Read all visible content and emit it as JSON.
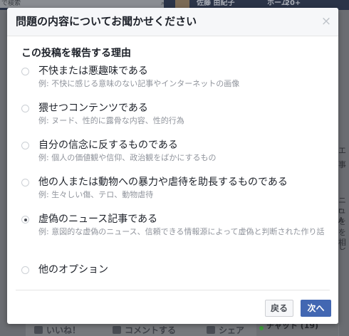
{
  "background": {
    "search_placeholder": "で検索",
    "user_name": "佐藤 由紀子",
    "home_label": "ホーム",
    "people_badge": "20+",
    "right_text_lines": [
      "エ",
      "事",
      "ニュ",
      "r A",
      "を",
      "を相",
      "し"
    ],
    "actions": {
      "like": "いいね！",
      "comment": "コメントする",
      "share": "シェア"
    },
    "chat_label": "チャット (19)"
  },
  "dialog": {
    "title": "問題の内容についてお聞かせください",
    "close_symbol": "×",
    "section_title": "この投稿を報告する理由",
    "options": [
      {
        "label": "不快または悪趣味である",
        "description": "例: 不快に感じる意味のない記事やインターネットの画像",
        "checked": false
      },
      {
        "label": "猥せつコンテンツである",
        "description": "例: ヌード、性的に露骨な内容、性的行為",
        "checked": false
      },
      {
        "label": "自分の信念に反するものである",
        "description": "例: 個人の価値観や信仰、政治観をばかにするもの",
        "checked": false
      },
      {
        "label": "他の人または動物への暴力や虐待を助長するものである",
        "description": "例: 生々しい傷、テロ、動物虐待",
        "checked": false
      },
      {
        "label": "虚偽のニュース記事である",
        "description": "例: 意図的な虚偽のニュース、信頼できる情報源によって虚偽と判断された作り話",
        "checked": true
      },
      {
        "label": "他のオプション",
        "description": "",
        "checked": false
      }
    ],
    "buttons": {
      "back": "戻る",
      "next": "次へ"
    }
  },
  "colors": {
    "primary_button": "#4267b2",
    "overlay": "#6b6d72"
  }
}
